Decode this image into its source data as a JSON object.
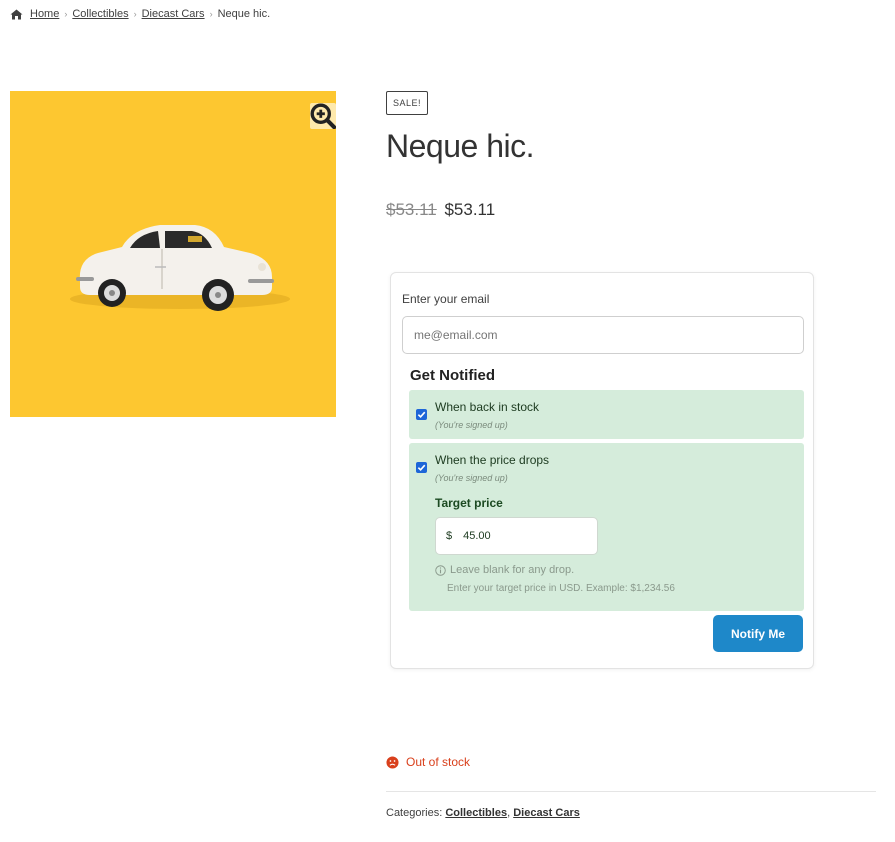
{
  "breadcrumb": {
    "home": "Home",
    "items": [
      "Collectibles",
      "Diecast Cars"
    ],
    "current": "Neque hic."
  },
  "product": {
    "badge": "SALE!",
    "title": "Neque hic.",
    "regular_price": "$53.11",
    "sale_price": "$53.11",
    "image_icon": "toy-car-image",
    "image_bg": "#fdc730"
  },
  "notify": {
    "email_label": "Enter your email",
    "email_placeholder": "me@email.com",
    "heading": "Get Notified",
    "options": [
      {
        "label": "When back in stock",
        "status": "(You're signed up)",
        "checked": true
      },
      {
        "label": "When the price drops",
        "status": "(You're signed up)",
        "checked": true
      }
    ],
    "target_label": "Target price",
    "currency": "$",
    "target_value": "45.00",
    "hint_blank": "Leave blank for any drop.",
    "hint_example": "Enter your target price in USD. Example: $1,234.56",
    "button": "Notify Me",
    "accent": "#1e88c9",
    "option_bg": "#d5ecdb"
  },
  "stock": {
    "text": "Out of stock",
    "color": "#d9401c"
  },
  "meta": {
    "label": "Categories:",
    "categories": [
      "Collectibles",
      "Diecast Cars"
    ]
  }
}
